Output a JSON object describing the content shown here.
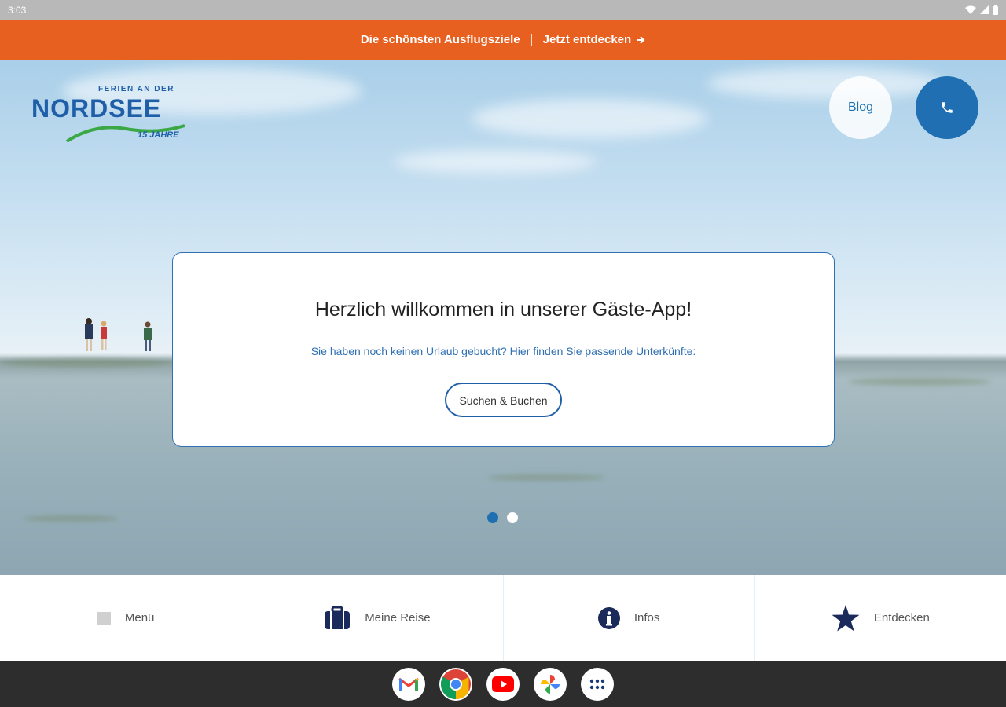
{
  "status": {
    "time": "3:03"
  },
  "promo": {
    "text": "Die schönsten Ausflugsziele",
    "link": "Jetzt entdecken"
  },
  "logo": {
    "subtitle": "FERIEN AN DER",
    "name": "NORDSEE",
    "years": "15 JAHRE"
  },
  "header": {
    "blog_label": "Blog",
    "call_icon": "phone-icon"
  },
  "welcome": {
    "title": "Herzlich willkommen in unserer Gäste-App!",
    "subtitle": "Sie haben noch keinen Urlaub gebucht? Hier finden Sie passende Unterkünfte:",
    "button": "Suchen & Buchen"
  },
  "carousel": {
    "slides": 2,
    "active": 1
  },
  "nav": {
    "items": [
      {
        "label": "Menü",
        "icon": "menu-icon"
      },
      {
        "label": "Meine Reise",
        "icon": "suitcase-icon"
      },
      {
        "label": "Infos",
        "icon": "info-icon"
      },
      {
        "label": "Entdecken",
        "icon": "star-icon"
      }
    ]
  },
  "taskbar": {
    "apps": [
      "gmail-icon",
      "chrome-icon",
      "youtube-icon",
      "photos-icon",
      "apps-grid-icon"
    ]
  },
  "colors": {
    "accent_orange": "#e8601f",
    "brand_blue": "#1f6fb2",
    "nav_icon": "#1a2a5a"
  }
}
